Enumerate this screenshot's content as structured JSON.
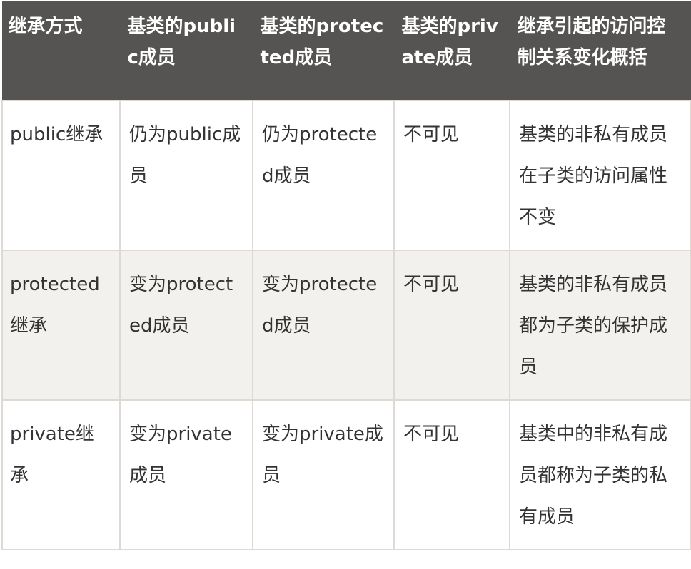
{
  "table": {
    "headers": [
      "继承方式",
      "基类的public成员",
      "基类的protected成员",
      "基类的private成员",
      "继承引起的访问控制关系变化概括"
    ],
    "rows": [
      {
        "cells": [
          "public继承",
          "仍为public成员",
          "仍为protected成员",
          "不可见",
          "基类的非私有成员在子类的访问属性不变"
        ]
      },
      {
        "cells": [
          "protected继承",
          "变为protected成员",
          "变为protected成员",
          "不可见",
          "基类的非私有成员都为子类的保护成员"
        ]
      },
      {
        "cells": [
          "private继承",
          "变为private成员",
          "变为private成员",
          "不可见",
          "基类中的非私有成员都称为子类的私有成员"
        ]
      }
    ]
  },
  "colors": {
    "header_bg": "#555452",
    "header_text": "#ffffff",
    "row_alt_bg": "#f3f1ed",
    "border": "#dddad5",
    "body_text": "#333333"
  }
}
